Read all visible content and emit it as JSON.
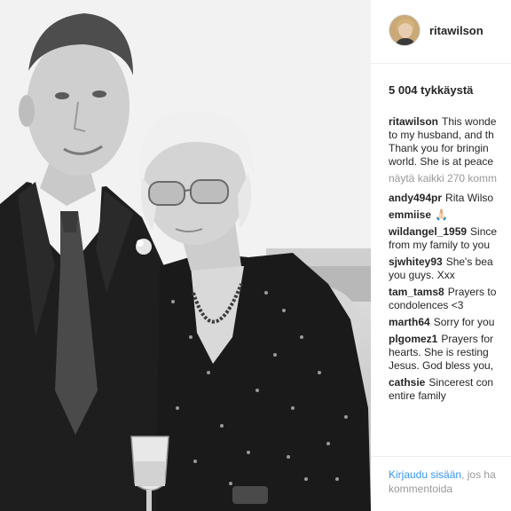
{
  "post": {
    "username": "ritawilson",
    "likes": "5 004 tykkäystä",
    "caption": {
      "username": "ritawilson",
      "lines": [
        "This wonde",
        "to my husband, and th",
        "Thank you for bringin",
        "world. She is at peace"
      ]
    },
    "view_all": "näytä kaikki 270 komm",
    "comments": [
      {
        "username": "andy494pr",
        "lines": [
          "Rita Wilso"
        ]
      },
      {
        "username": "emmiise",
        "lines": [
          "🙏🏻"
        ]
      },
      {
        "username": "wildangel_1959",
        "lines": [
          "Since",
          "from my family to you"
        ]
      },
      {
        "username": "sjwhitey93",
        "lines": [
          "She's bea",
          "you guys. Xxx"
        ]
      },
      {
        "username": "tam_tams8",
        "lines": [
          "Prayers to",
          "condolences <3"
        ]
      },
      {
        "username": "marth64",
        "lines": [
          "Sorry for you"
        ]
      },
      {
        "username": "plgomez1",
        "lines": [
          "Prayers for",
          "hearts. She is resting",
          "Jesus. God bless you,"
        ]
      },
      {
        "username": "cathsie",
        "lines": [
          "Sincerest con",
          "entire family"
        ]
      }
    ],
    "footer": {
      "login_link": "Kirjaudu sisään",
      "rest_1": ", jos ha",
      "rest_2": "kommentoida"
    }
  },
  "colors": {
    "text": "#262626",
    "muted": "#999999",
    "link": "#3897f0",
    "border": "#efefef"
  }
}
